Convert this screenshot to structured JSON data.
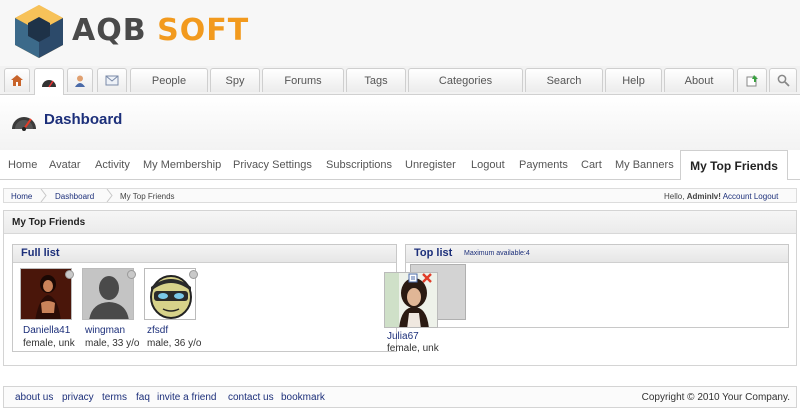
{
  "header": {
    "logo_primary": "AQB",
    "logo_secondary": "SOFT"
  },
  "topnav": {
    "home_icon": "house-icon",
    "dashboard_icon": "speedometer-icon",
    "profile_icon": "user-icon",
    "mail_icon": "envelope-icon",
    "items": [
      "People",
      "Spy",
      "Forums",
      "Tags",
      "Categories",
      "Search",
      "Help",
      "About"
    ],
    "add_icon": "add-page-icon",
    "search_icon": "magnifier-icon"
  },
  "page": {
    "title": "Dashboard",
    "icon": "speedometer-icon"
  },
  "subnav": {
    "items": [
      "Home",
      "Avatar",
      "Activity",
      "My Membership",
      "Privacy Settings",
      "Subscriptions",
      "Unregister",
      "Logout",
      "Payments",
      "Cart",
      "My Banners"
    ],
    "active": "My Top Friends"
  },
  "breadcrumb": {
    "items": [
      "Home",
      "Dashboard",
      "My Top Friends"
    ],
    "greeting_prefix": "Hello,",
    "user": "Adminlv!",
    "account": "Account",
    "logout": "Logout"
  },
  "panel": {
    "title": "My Top Friends",
    "full_list_title": "Full list",
    "top_list_title": "Top list",
    "top_list_note": "Maximum available:4"
  },
  "friends": [
    {
      "name": "Daniella41",
      "info": "female, unk"
    },
    {
      "name": "wingman",
      "info": "male, 33 y/o"
    },
    {
      "name": "zfsdf",
      "info": "male, 36 y/o"
    }
  ],
  "dragging": {
    "name": "Julia67",
    "info": "female, unk"
  },
  "footer": {
    "links": [
      "about us",
      "privacy",
      "terms",
      "faq",
      "invite a friend",
      "contact us",
      "bookmark"
    ],
    "copyright": "Copyright © 2010 Your Company."
  },
  "colors": {
    "accent_blue": "#1c2f7a",
    "logo_orange": "#f29a1e",
    "remove_red": "#e03c28"
  }
}
